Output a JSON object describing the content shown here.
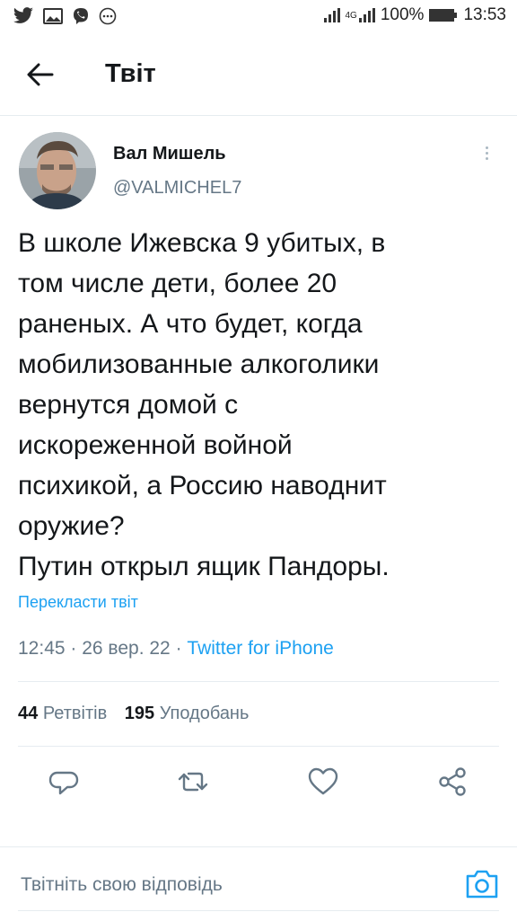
{
  "status_bar": {
    "network": "4G",
    "battery": "100%",
    "time": "13:53"
  },
  "header": {
    "title": "Твіт"
  },
  "tweet": {
    "author_name": "Вал Мишель",
    "author_handle": "@VALMICHEL7",
    "text": "В школе Ижевска 9 убитых, в\nтом числе дети, более 20\nраненых. А что будет, когда\nмобилизованные алкоголики\nвернутся домой с\nискореженной войной\nпсихикой, а Россию наводнит\nоружие?\nПутин открыл ящик Пандоры.",
    "translate_label": "Перекласти твіт",
    "time": "12:45",
    "date": "26 вер. 22",
    "source": "Twitter for iPhone",
    "retweets_count": "44",
    "retweets_label": "Ретвітів",
    "likes_count": "195",
    "likes_label": "Уподобань"
  },
  "reply": {
    "placeholder": "Твітніть свою відповідь"
  },
  "icons": {
    "accent": "#1da1f2",
    "action_gray": "#657786"
  }
}
